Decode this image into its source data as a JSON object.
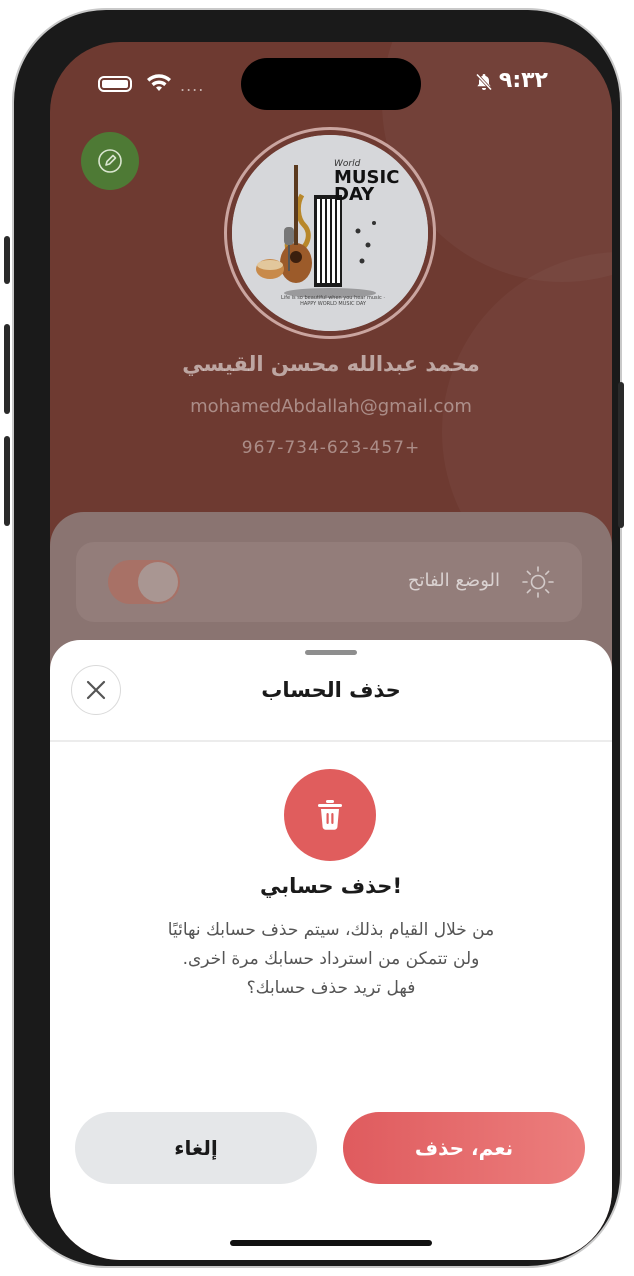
{
  "status_bar": {
    "time": "٩:٣٢",
    "carrier": "....",
    "icons": [
      "battery-icon",
      "wifi-icon",
      "bell-off-icon"
    ]
  },
  "profile": {
    "name": "محمد عبدالله محسن القيسي",
    "email": "mohamedAbdallah@gmail.com",
    "phone": "967-734-623-457+",
    "avatar_text": {
      "world": "World",
      "title": "MUSIC DAY",
      "tagline": "Life is so beautiful when you hear music · HAPPY WORLD MUSIC DAY"
    }
  },
  "settings": {
    "light_mode_label": "الوضع الفاتح",
    "light_mode_on": false
  },
  "delete_sheet": {
    "title": "حذف الحساب",
    "warning_title": "حذف حسابي!",
    "warning_lines": [
      "من خلال القيام بذلك، سيتم حذف حسابك نهائيًا",
      "ولن تتمكن من استرداد حسابك مرة اخرى.",
      "فهل تريد حذف حسابك؟"
    ],
    "confirm_label": "نعم، حذف",
    "cancel_label": "إلغاء"
  },
  "colors": {
    "header_bg": "#6e3a31",
    "accent_red": "#e05d5d",
    "edit_green": "#4e7a35"
  }
}
